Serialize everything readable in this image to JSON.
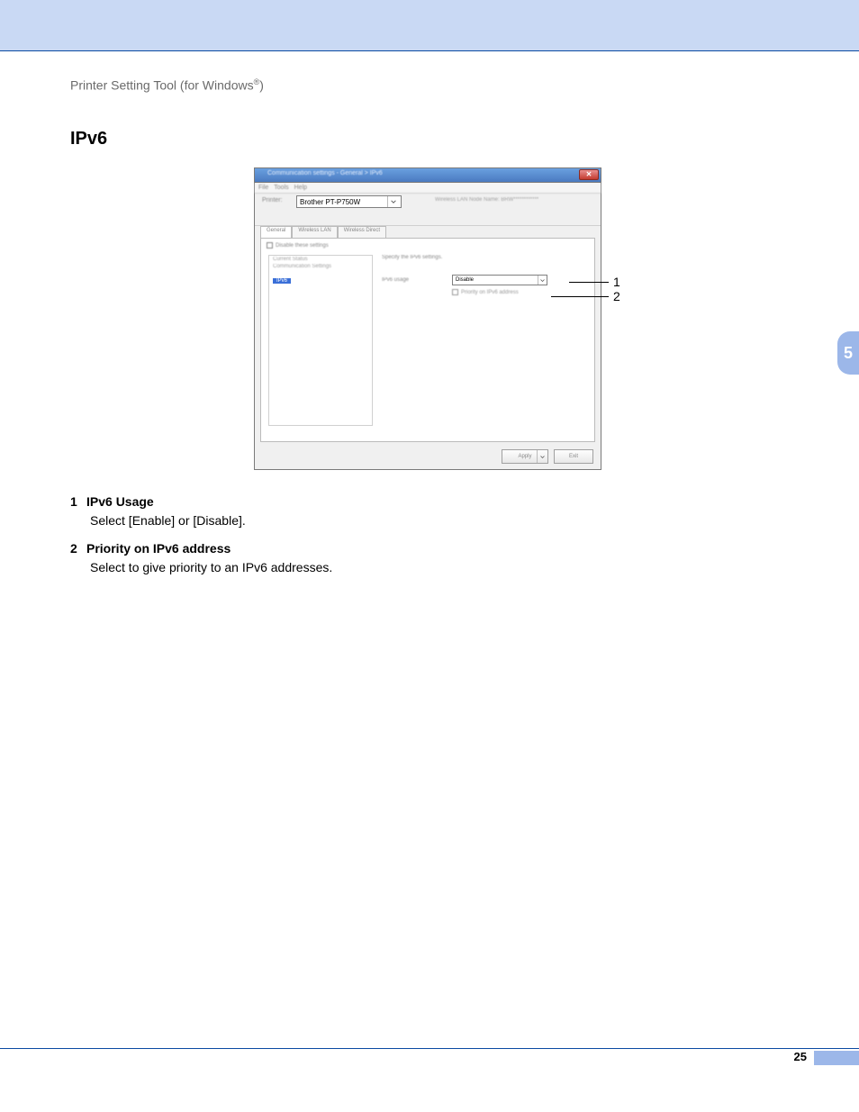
{
  "header": {
    "breadcrumb_pre": "Printer Setting Tool (for Windows",
    "breadcrumb_sup": "®",
    "breadcrumb_post": ")"
  },
  "section_title": "IPv6",
  "chapter_number": "5",
  "page_number": "25",
  "screenshot": {
    "titlebar": "Communication settings - General > IPv6",
    "menubar": {
      "file": "File",
      "tools": "Tools",
      "help": "Help"
    },
    "printer_label": "Printer:",
    "printer_value": "Brother PT-P750W",
    "node_label": "Wireless LAN Node Name: BRW************",
    "tabs": {
      "general": "General",
      "wlan": "Wireless LAN",
      "wdirect": "Wireless Direct"
    },
    "disable_settings": "Disable these settings",
    "tree": {
      "current_status": "Current Status",
      "comm_settings": "Communication Settings",
      "ipv6": "IPv6"
    },
    "specify": "Specify the IPv6 settings.",
    "ipv6_usage_label": "IPv6 usage",
    "ipv6_usage_value": "Disable",
    "priority_label": "Priority on IPv6 address",
    "buttons": {
      "apply": "Apply",
      "exit": "Exit"
    }
  },
  "callouts": {
    "one": "1",
    "two": "2"
  },
  "list": {
    "item1_num": "1",
    "item1_title": "IPv6 Usage",
    "item1_desc": "Select [Enable] or [Disable].",
    "item2_num": "2",
    "item2_title": "Priority on IPv6 address",
    "item2_desc": "Select to give priority to an IPv6 addresses."
  }
}
